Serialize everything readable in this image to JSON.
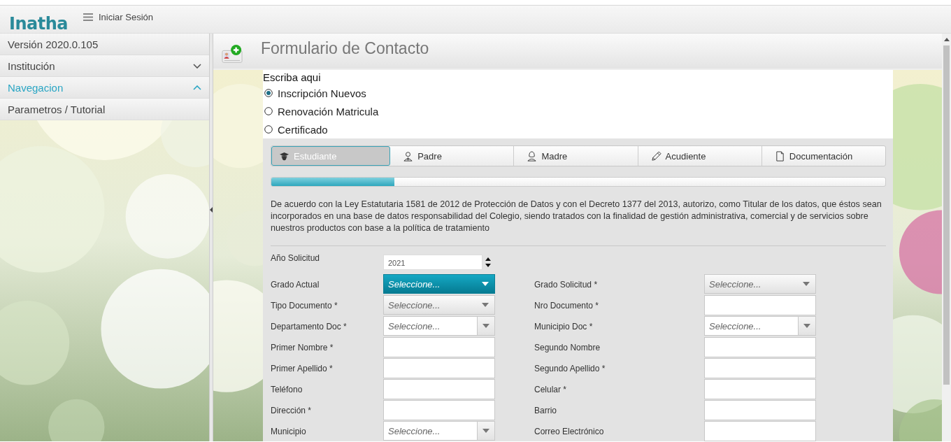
{
  "topbar": {
    "logo": "Inatha",
    "menu_label": "Iniciar Sesión"
  },
  "sidebar": {
    "items": [
      {
        "label": "Versión 2020.0.105",
        "kind": "text"
      },
      {
        "label": "Institución",
        "kind": "section",
        "expanded": false
      },
      {
        "label": "Navegacion",
        "kind": "section",
        "expanded": true
      },
      {
        "label": "Parametros / Tutorial",
        "kind": "text"
      }
    ]
  },
  "page": {
    "title": "Formulario de Contacto"
  },
  "request_type": {
    "prompt": "Escriba aqui",
    "options": [
      {
        "label": "Inscripción Nuevos",
        "selected": true
      },
      {
        "label": "Renovación Matricula",
        "selected": false
      },
      {
        "label": "Certificado",
        "selected": false
      }
    ]
  },
  "steps": [
    {
      "label": "Estudiante",
      "selected": true
    },
    {
      "label": "Padre",
      "selected": false
    },
    {
      "label": "Madre",
      "selected": false
    },
    {
      "label": "Acudiente",
      "selected": false
    },
    {
      "label": "Documentación",
      "selected": false
    }
  ],
  "progress": {
    "level": 0.2
  },
  "notice": "De acuerdo con la Ley Estatutaria 1581 de 2012 de Protección de Datos y con el Decreto 1377 del 2013, autorizo, como Titular de los datos, que éstos sean incorporados en una base de datos responsabilidad del Colegio, siendo tratados con la finalidad de gestión administrativa, comercial y de servicios sobre nuestros productos con base a la política de tratamiento",
  "form_rows": [
    [
      {
        "label": "Año Solicitud",
        "kind": "number",
        "value": "2021"
      }
    ],
    [
      {
        "label": "Grado Actual",
        "kind": "dropdown",
        "focused": true,
        "placeholder": "Seleccione..."
      },
      {
        "label": "Grado Solicitud *",
        "kind": "dropdown",
        "focused": false,
        "placeholder": "Seleccione..."
      }
    ],
    [
      {
        "label": "Tipo Documento *",
        "kind": "dropdown",
        "focused": false,
        "placeholder": "Seleccione..."
      },
      {
        "label": "Nro Documento *",
        "kind": "text"
      }
    ],
    [
      {
        "label": "Departamento Doc *",
        "kind": "combo",
        "focused": false,
        "placeholder": "Seleccione..."
      },
      {
        "label": "Municipio Doc *",
        "kind": "combo",
        "focused": false,
        "placeholder": "Seleccione..."
      }
    ],
    [
      {
        "label": "Primer Nombre *",
        "kind": "text"
      },
      {
        "label": "Segundo Nombre",
        "kind": "text"
      }
    ],
    [
      {
        "label": "Primer Apellido *",
        "kind": "text"
      },
      {
        "label": "Segundo Apellido *",
        "kind": "text"
      }
    ],
    [
      {
        "label": "Teléfono",
        "kind": "text"
      },
      {
        "label": "Celular *",
        "kind": "text"
      }
    ],
    [
      {
        "label": "Dirección *",
        "kind": "text"
      },
      {
        "label": "Barrio",
        "kind": "text"
      }
    ],
    [
      {
        "label": "Municipio",
        "kind": "combo",
        "focused": false,
        "placeholder": "Seleccione..."
      },
      {
        "label": "Correo Electrónico",
        "kind": "text"
      }
    ]
  ]
}
